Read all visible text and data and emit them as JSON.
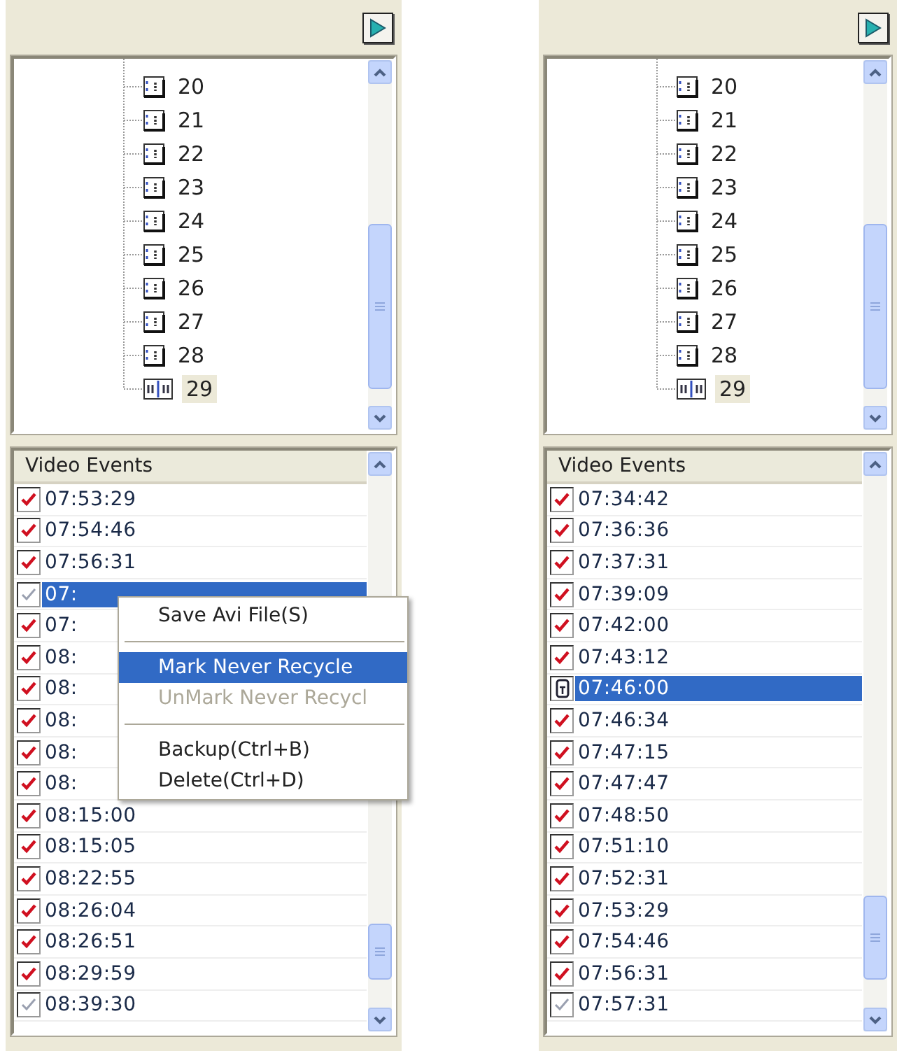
{
  "panels": [
    {
      "tree": [
        {
          "label": "20",
          "selected": false
        },
        {
          "label": "21",
          "selected": false
        },
        {
          "label": "22",
          "selected": false
        },
        {
          "label": "23",
          "selected": false
        },
        {
          "label": "24",
          "selected": false
        },
        {
          "label": "25",
          "selected": false
        },
        {
          "label": "26",
          "selected": false
        },
        {
          "label": "27",
          "selected": false
        },
        {
          "label": "28",
          "selected": false
        },
        {
          "label": "29",
          "selected": true
        }
      ],
      "events": {
        "header": "Video Events",
        "rows": [
          {
            "time": "07:53:29",
            "kind": "check",
            "selected": false
          },
          {
            "time": "07:54:46",
            "kind": "check",
            "selected": false
          },
          {
            "time": "07:56:31",
            "kind": "check",
            "selected": false
          },
          {
            "time": "07:",
            "kind": "dim",
            "selected": true
          },
          {
            "time": "07:",
            "kind": "check",
            "selected": false
          },
          {
            "time": "08:",
            "kind": "check",
            "selected": false
          },
          {
            "time": "08:",
            "kind": "check",
            "selected": false
          },
          {
            "time": "08:",
            "kind": "check",
            "selected": false
          },
          {
            "time": "08:",
            "kind": "check",
            "selected": false
          },
          {
            "time": "08:",
            "kind": "check",
            "selected": false
          },
          {
            "time": "08:15:00",
            "kind": "check",
            "selected": false
          },
          {
            "time": "08:15:05",
            "kind": "check",
            "selected": false
          },
          {
            "time": "08:22:55",
            "kind": "check",
            "selected": false
          },
          {
            "time": "08:26:04",
            "kind": "check",
            "selected": false
          },
          {
            "time": "08:26:51",
            "kind": "check",
            "selected": false
          },
          {
            "time": "08:29:59",
            "kind": "check",
            "selected": false
          },
          {
            "time": "08:39:30",
            "kind": "dim",
            "selected": false
          }
        ]
      },
      "context_menu": [
        {
          "kind": "item",
          "label": "Save Avi File(S)",
          "selected": false,
          "disabled": false
        },
        {
          "kind": "separator"
        },
        {
          "kind": "item",
          "label": "Mark Never Recycle",
          "selected": true,
          "disabled": false
        },
        {
          "kind": "item",
          "label": "UnMark Never Recycl",
          "selected": false,
          "disabled": true
        },
        {
          "kind": "separator"
        },
        {
          "kind": "item",
          "label": "Backup(Ctrl+B)",
          "selected": false,
          "disabled": false
        },
        {
          "kind": "item",
          "label": "Delete(Ctrl+D)",
          "selected": false,
          "disabled": false
        }
      ]
    },
    {
      "tree": [
        {
          "label": "20",
          "selected": false
        },
        {
          "label": "21",
          "selected": false
        },
        {
          "label": "22",
          "selected": false
        },
        {
          "label": "23",
          "selected": false
        },
        {
          "label": "24",
          "selected": false
        },
        {
          "label": "25",
          "selected": false
        },
        {
          "label": "26",
          "selected": false
        },
        {
          "label": "27",
          "selected": false
        },
        {
          "label": "28",
          "selected": false
        },
        {
          "label": "29",
          "selected": true
        }
      ],
      "events": {
        "header": "Video Events",
        "rows": [
          {
            "time": "07:34:42",
            "kind": "check",
            "selected": false
          },
          {
            "time": "07:36:36",
            "kind": "check",
            "selected": false
          },
          {
            "time": "07:37:31",
            "kind": "check",
            "selected": false
          },
          {
            "time": "07:39:09",
            "kind": "check",
            "selected": false
          },
          {
            "time": "07:42:00",
            "kind": "check",
            "selected": false
          },
          {
            "time": "07:43:12",
            "kind": "check",
            "selected": false
          },
          {
            "time": "07:46:00",
            "kind": "lock",
            "selected": true
          },
          {
            "time": "07:46:34",
            "kind": "check",
            "selected": false
          },
          {
            "time": "07:47:15",
            "kind": "check",
            "selected": false
          },
          {
            "time": "07:47:47",
            "kind": "check",
            "selected": false
          },
          {
            "time": "07:48:50",
            "kind": "check",
            "selected": false
          },
          {
            "time": "07:51:10",
            "kind": "check",
            "selected": false
          },
          {
            "time": "07:52:31",
            "kind": "check",
            "selected": false
          },
          {
            "time": "07:53:29",
            "kind": "check",
            "selected": false
          },
          {
            "time": "07:54:46",
            "kind": "check",
            "selected": false
          },
          {
            "time": "07:56:31",
            "kind": "check",
            "selected": false
          },
          {
            "time": "07:57:31",
            "kind": "dim",
            "selected": false
          }
        ]
      }
    }
  ]
}
